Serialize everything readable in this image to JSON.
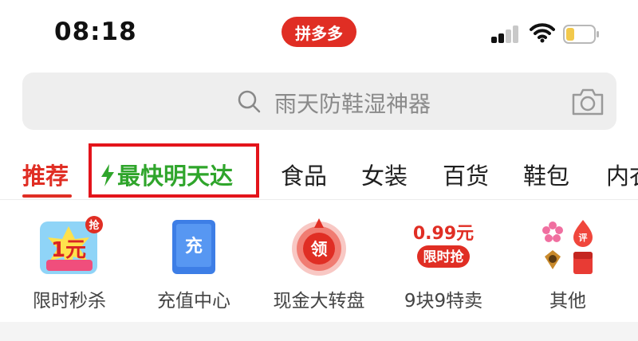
{
  "status_bar": {
    "time": "08:18",
    "brand": "拼多多"
  },
  "search": {
    "placeholder": "雨天防鞋湿神器"
  },
  "tabs": [
    {
      "label": "推荐",
      "active": true
    },
    {
      "label": "最快明天达",
      "highlighted": true
    },
    {
      "label": "食品"
    },
    {
      "label": "女装"
    },
    {
      "label": "百货"
    },
    {
      "label": "鞋包"
    },
    {
      "label": "内衣"
    }
  ],
  "shortcuts": [
    {
      "label": "限时秒杀",
      "icon_text": "1元",
      "badge": "抢"
    },
    {
      "label": "充值中心",
      "icon_text": "充"
    },
    {
      "label": "现金大转盘",
      "icon_text": "领"
    },
    {
      "label": "9块9特卖",
      "icon_price": "0.99元",
      "icon_text": "限时抢"
    },
    {
      "label": "其他",
      "icon_text": "评"
    }
  ],
  "colors": {
    "brand_red": "#e02e24",
    "express_green": "#2fa52b",
    "highlight_box": "#e3141b"
  }
}
